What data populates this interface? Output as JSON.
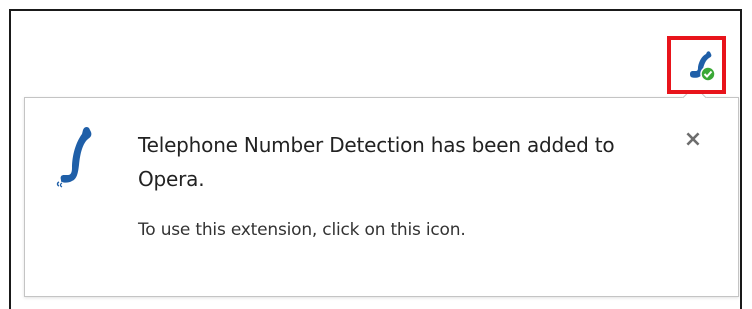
{
  "extension_button": {
    "icon": "telephone-icon",
    "badge_icon": "check-badge-icon",
    "highlight_color": "#e8141b"
  },
  "popup": {
    "icon": "telephone-icon",
    "title": "Telephone Number Detection has been added to Opera.",
    "subtitle": "To use this extension, click on this icon.",
    "close_label": "×"
  },
  "colors": {
    "phone_blue": "#1f5fa8",
    "badge_green": "#3aa835"
  }
}
